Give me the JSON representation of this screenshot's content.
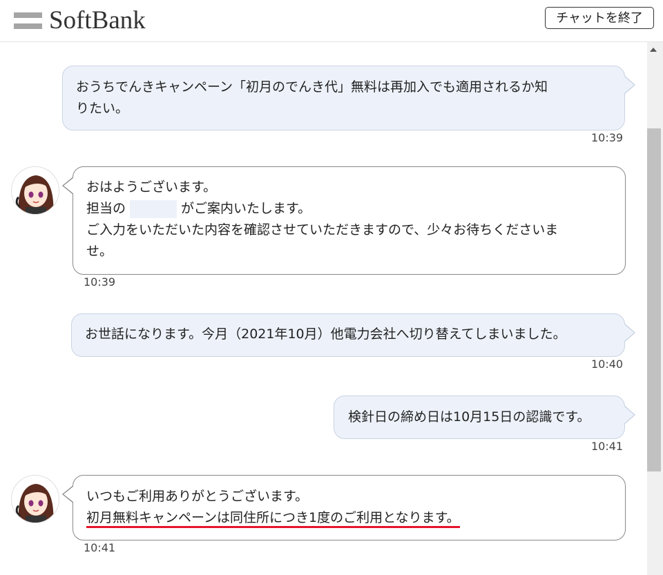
{
  "header": {
    "logo_text": "SoftBank",
    "end_chat_label": "チャットを終了"
  },
  "messages": [
    {
      "role": "user",
      "lines": [
        "おうちでんきキャンペーン「初月のでんき代」無料は再加入でも適用されるか知",
        "りたい。"
      ],
      "time": "10:39"
    },
    {
      "role": "agent",
      "lines": [
        "おはようございます。",
        "担当の",
        "がご案内いたします。",
        "ご入力をいただいた内容を確認させていただきますので、少々お待ちくださいま",
        "せ。"
      ],
      "time": "10:39"
    },
    {
      "role": "user",
      "lines": [
        "お世話になります。今月（2021年10月）他電力会社へ切り替えてしまいました。"
      ],
      "time": "10:40"
    },
    {
      "role": "user",
      "lines": [
        "検針日の締め日は10月15日の認識です。"
      ],
      "time": "10:41"
    },
    {
      "role": "agent",
      "lines": [
        "いつもご利用ありがとうございます。",
        "初月無料キャンペーンは同住所につき1度のご利用となります。"
      ],
      "time": "10:41"
    }
  ],
  "colors": {
    "user_bubble_bg": "#edf2fa",
    "agent_bubble_border": "#888888",
    "highlight_underline": "#e8132b"
  }
}
